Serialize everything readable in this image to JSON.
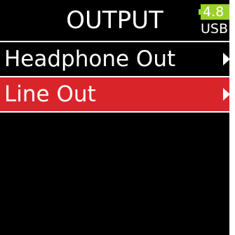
{
  "header": {
    "title": "OUTPUT",
    "battery": {
      "voltage": "4.8",
      "color": "#9ad12b",
      "icon": "battery-icon"
    },
    "power_source": "USB"
  },
  "menu": {
    "items": [
      {
        "label": "Headphone Out",
        "selected": false,
        "icon": "chevron-right-icon"
      },
      {
        "label": "Line Out",
        "selected": true,
        "icon": "chevron-right-icon"
      }
    ],
    "selected_color": "#d9252a"
  }
}
